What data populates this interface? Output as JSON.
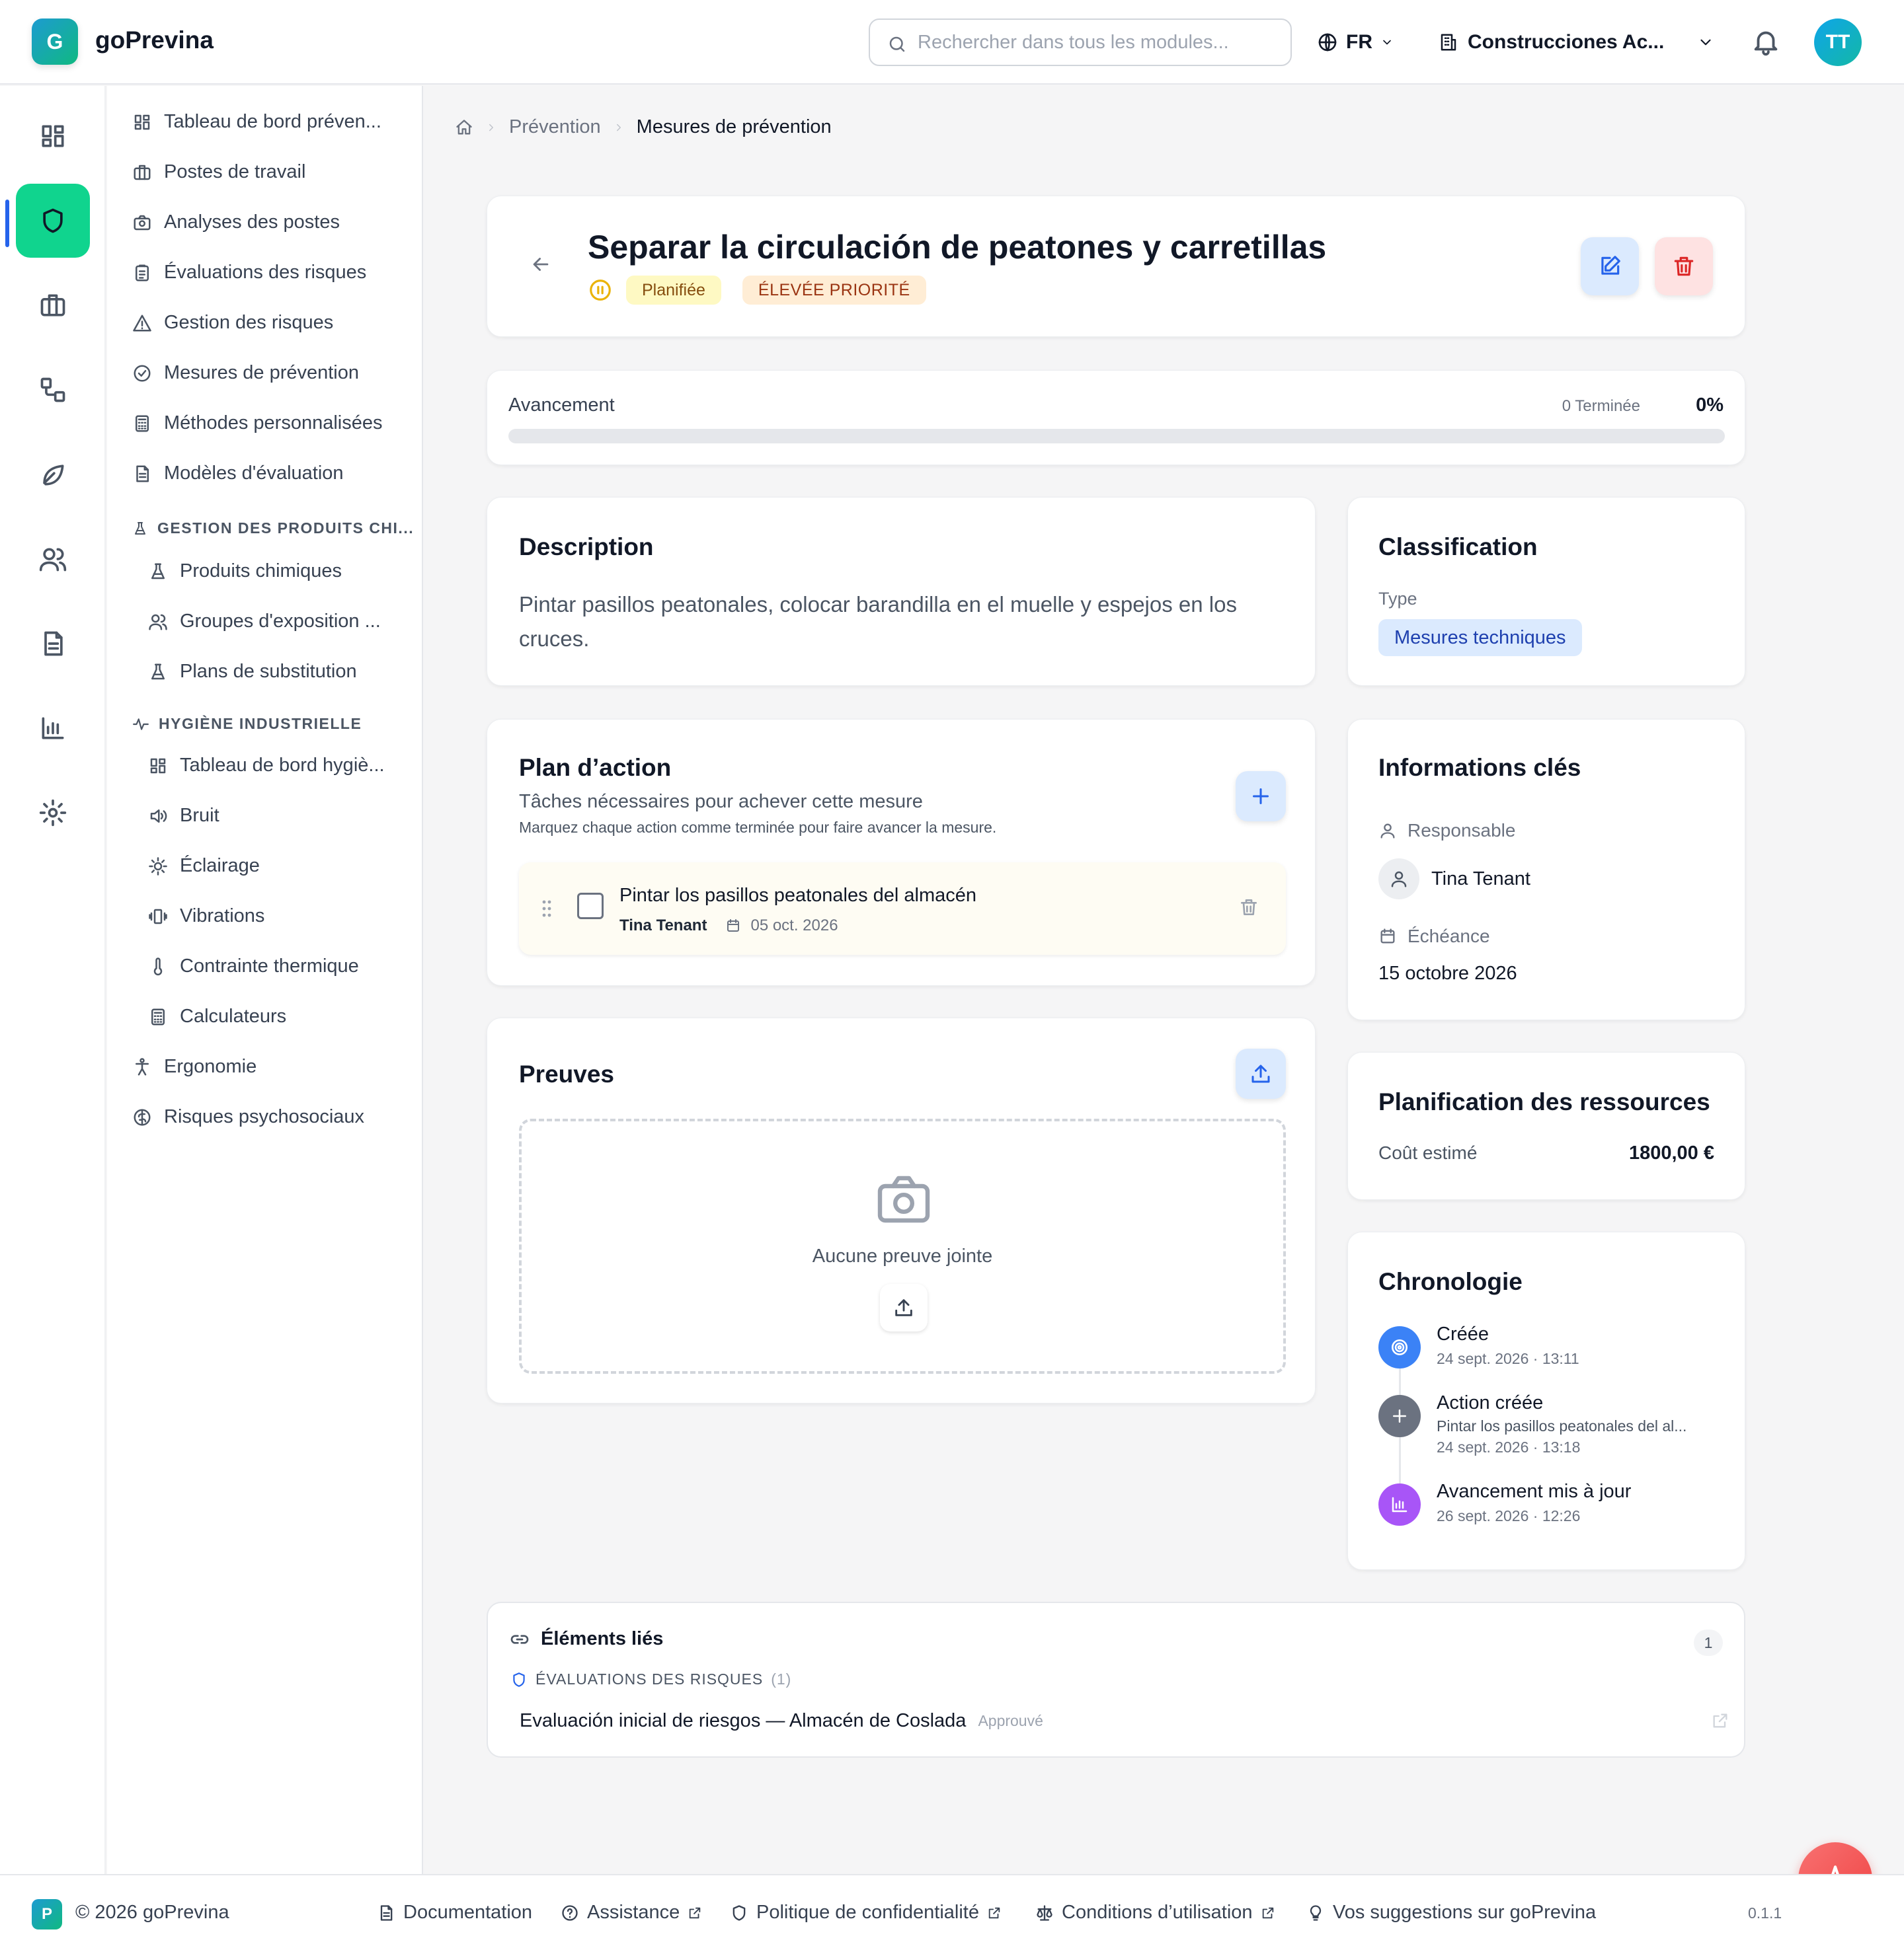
{
  "header": {
    "logo_letter": "G",
    "app_name": "goPrevina",
    "search_placeholder": "Rechercher dans tous les modules...",
    "language": "FR",
    "company": "Construcciones Ac...",
    "avatar_initials": "TT"
  },
  "rail_icons": [
    "dashboard-icon",
    "shield-icon",
    "briefcase-icon",
    "workflow-icon",
    "leaf-icon",
    "users-icon",
    "document-icon",
    "bar-chart-icon",
    "settings-icon"
  ],
  "sidebar": {
    "items": [
      {
        "label": "Tableau de bord préven...",
        "icon": "grid-icon"
      },
      {
        "label": "Postes de travail",
        "icon": "building-icon"
      },
      {
        "label": "Analyses des postes",
        "icon": "camera-icon"
      },
      {
        "label": "Évaluations des risques",
        "icon": "clipboard-icon"
      },
      {
        "label": "Gestion des risques",
        "icon": "warning-icon"
      },
      {
        "label": "Mesures de prévention",
        "icon": "check-circle-icon"
      },
      {
        "label": "Méthodes personnalisées",
        "icon": "calculator-icon"
      },
      {
        "label": "Modèles d'évaluation",
        "icon": "file-icon"
      }
    ],
    "chem_header": "GESTION DES PRODUITS CHI...",
    "chem_items": [
      {
        "label": "Produits chimiques",
        "icon": "flask-icon"
      },
      {
        "label": "Groupes d'exposition ...",
        "icon": "users-icon"
      },
      {
        "label": "Plans de substitution",
        "icon": "flask-icon"
      }
    ],
    "hyg_header": "HYGIÈNE INDUSTRIELLE",
    "hyg_items": [
      {
        "label": "Tableau de bord hygiè...",
        "icon": "grid-icon"
      },
      {
        "label": "Bruit",
        "icon": "speaker-icon"
      },
      {
        "label": "Éclairage",
        "icon": "sun-icon"
      },
      {
        "label": "Vibrations",
        "icon": "vibration-icon"
      },
      {
        "label": "Contrainte thermique",
        "icon": "thermometer-icon"
      },
      {
        "label": "Calculateurs",
        "icon": "calculator-icon"
      }
    ],
    "tail_items": [
      {
        "label": "Ergonomie",
        "icon": "person-icon"
      },
      {
        "label": "Risques psychosociaux",
        "icon": "brain-icon"
      }
    ]
  },
  "breadcrumb": {
    "section": "Prévention",
    "current": "Mesures de prévention"
  },
  "measure": {
    "title": "Separar la circulación de peatones y carretillas",
    "status": "Planifiée",
    "priority": "ÉLEVÉE PRIORITÉ"
  },
  "progress": {
    "label": "Avancement",
    "done_text": "0 Terminée",
    "percent_text": "0%",
    "value": 0
  },
  "description": {
    "title": "Description",
    "text": "Pintar pasillos peatonales, colocar barandilla en el muelle y espejos en los cruces."
  },
  "action_plan": {
    "title": "Plan d’action",
    "subtitle": "Tâches nécessaires pour achever cette mesure",
    "hint": "Marquez chaque action comme terminée pour faire avancer la mesure.",
    "items": [
      {
        "title": "Pintar los pasillos peatonales del almacén",
        "assignee": "Tina Tenant",
        "date": "05 oct. 2026"
      }
    ]
  },
  "evidence": {
    "title": "Preuves",
    "empty_text": "Aucune preuve jointe"
  },
  "classification": {
    "title": "Classification",
    "type_label": "Type",
    "type_value": "Mesures techniques"
  },
  "key_info": {
    "title": "Informations clés",
    "owner_label": "Responsable",
    "owner_name": "Tina Tenant",
    "due_label": "Échéance",
    "due_value": "15 octobre 2026"
  },
  "resources": {
    "title": "Planification des ressources",
    "cost_label": "Coût estimé",
    "cost_value": "1800,00 €"
  },
  "timeline": {
    "title": "Chronologie",
    "events": [
      {
        "title": "Créée",
        "detail": "",
        "time": "24 sept. 2026 · 13:11",
        "color": "#3b82f6"
      },
      {
        "title": "Action créée",
        "detail": "Pintar los pasillos peatonales del al...",
        "time": "24 sept. 2026 · 13:18",
        "color": "#6b7280"
      },
      {
        "title": "Avancement mis à jour",
        "detail": "",
        "time": "26 sept. 2026 · 12:26",
        "color": "#a855f7"
      }
    ]
  },
  "linked": {
    "title": "Éléments liés",
    "count": "1",
    "group_label": "ÉVALUATIONS DES RISQUES",
    "group_count": "(1)",
    "item_title": "Evaluación inicial de riesgos — Almacén de Coslada",
    "item_status": "Approuvé"
  },
  "footer": {
    "logo_letter": "P",
    "copyright": "© 2026 goPrevina",
    "documentation": "Documentation",
    "support": "Assistance",
    "privacy": "Politique de confidentialité",
    "terms": "Conditions d’utilisation",
    "feedback": "Vos suggestions sur goPrevina",
    "version": "0.1.1"
  },
  "colors": {
    "accent_green": "#10d48e",
    "primary_blue": "#2563eb",
    "danger_red": "#dc2626",
    "status_yellow_bg": "#fef9c3",
    "priority_orange_bg": "#ffedd5"
  }
}
